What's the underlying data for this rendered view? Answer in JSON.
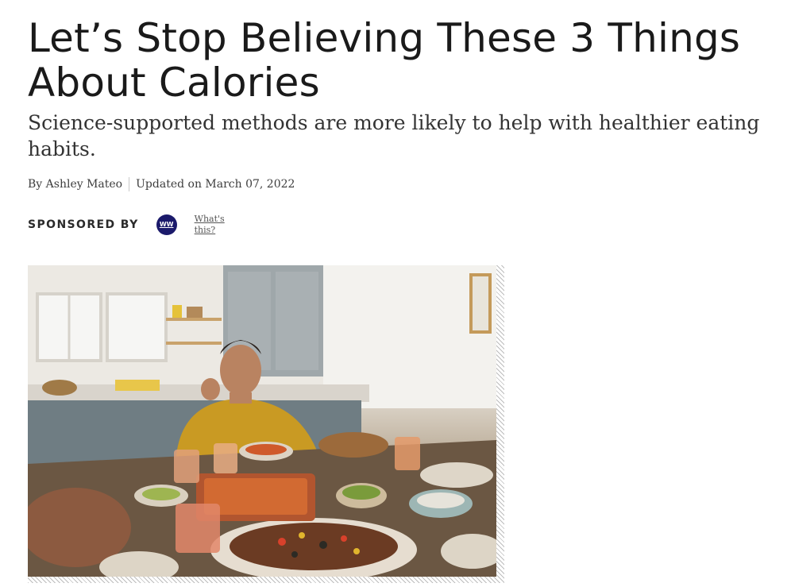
{
  "article": {
    "title": "Let’s Stop Believing These 3 Things About Calories",
    "subtitle": "Science-supported methods are more likely to help with healthier eating habits.",
    "byline": {
      "prefix": "By",
      "author": "Ashley Mateo",
      "updated": "Updated on March 07, 2022"
    },
    "sponsor": {
      "label": "SPONSORED BY",
      "logo_text": "WW",
      "whats_this": "What's this?"
    }
  },
  "figure": {
    "image_icon": "hero-photo"
  },
  "colors": {
    "text": "#1a1a1a",
    "logo_bg": "#1b1a6b",
    "divider": "#c9c9c9"
  }
}
